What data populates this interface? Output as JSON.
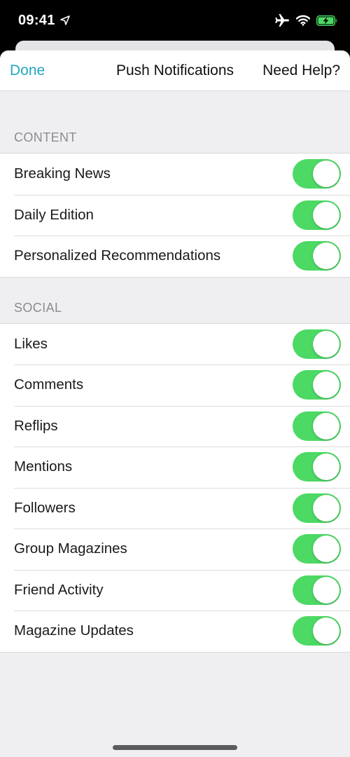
{
  "status_bar": {
    "time": "09:41",
    "icons": [
      "location-arrow-icon",
      "airplane-icon",
      "wifi-icon",
      "battery-charging-icon"
    ],
    "battery_color": "#4cd964"
  },
  "navbar": {
    "left_button": "Done",
    "title": "Push Notifications",
    "right_button": "Need Help?",
    "accent_color": "#23a6bf"
  },
  "sections": [
    {
      "header": "CONTENT",
      "items": [
        {
          "label": "Breaking News",
          "enabled": true
        },
        {
          "label": "Daily Edition",
          "enabled": true
        },
        {
          "label": "Personalized Recommendations",
          "enabled": true
        }
      ]
    },
    {
      "header": "SOCIAL",
      "items": [
        {
          "label": "Likes",
          "enabled": true
        },
        {
          "label": "Comments",
          "enabled": true
        },
        {
          "label": "Reflips",
          "enabled": true
        },
        {
          "label": "Mentions",
          "enabled": true
        },
        {
          "label": "Followers",
          "enabled": true
        },
        {
          "label": "Group Magazines",
          "enabled": true
        },
        {
          "label": "Friend Activity",
          "enabled": true
        },
        {
          "label": "Magazine Updates",
          "enabled": true
        }
      ]
    }
  ],
  "toggle_on_color": "#4cd964"
}
